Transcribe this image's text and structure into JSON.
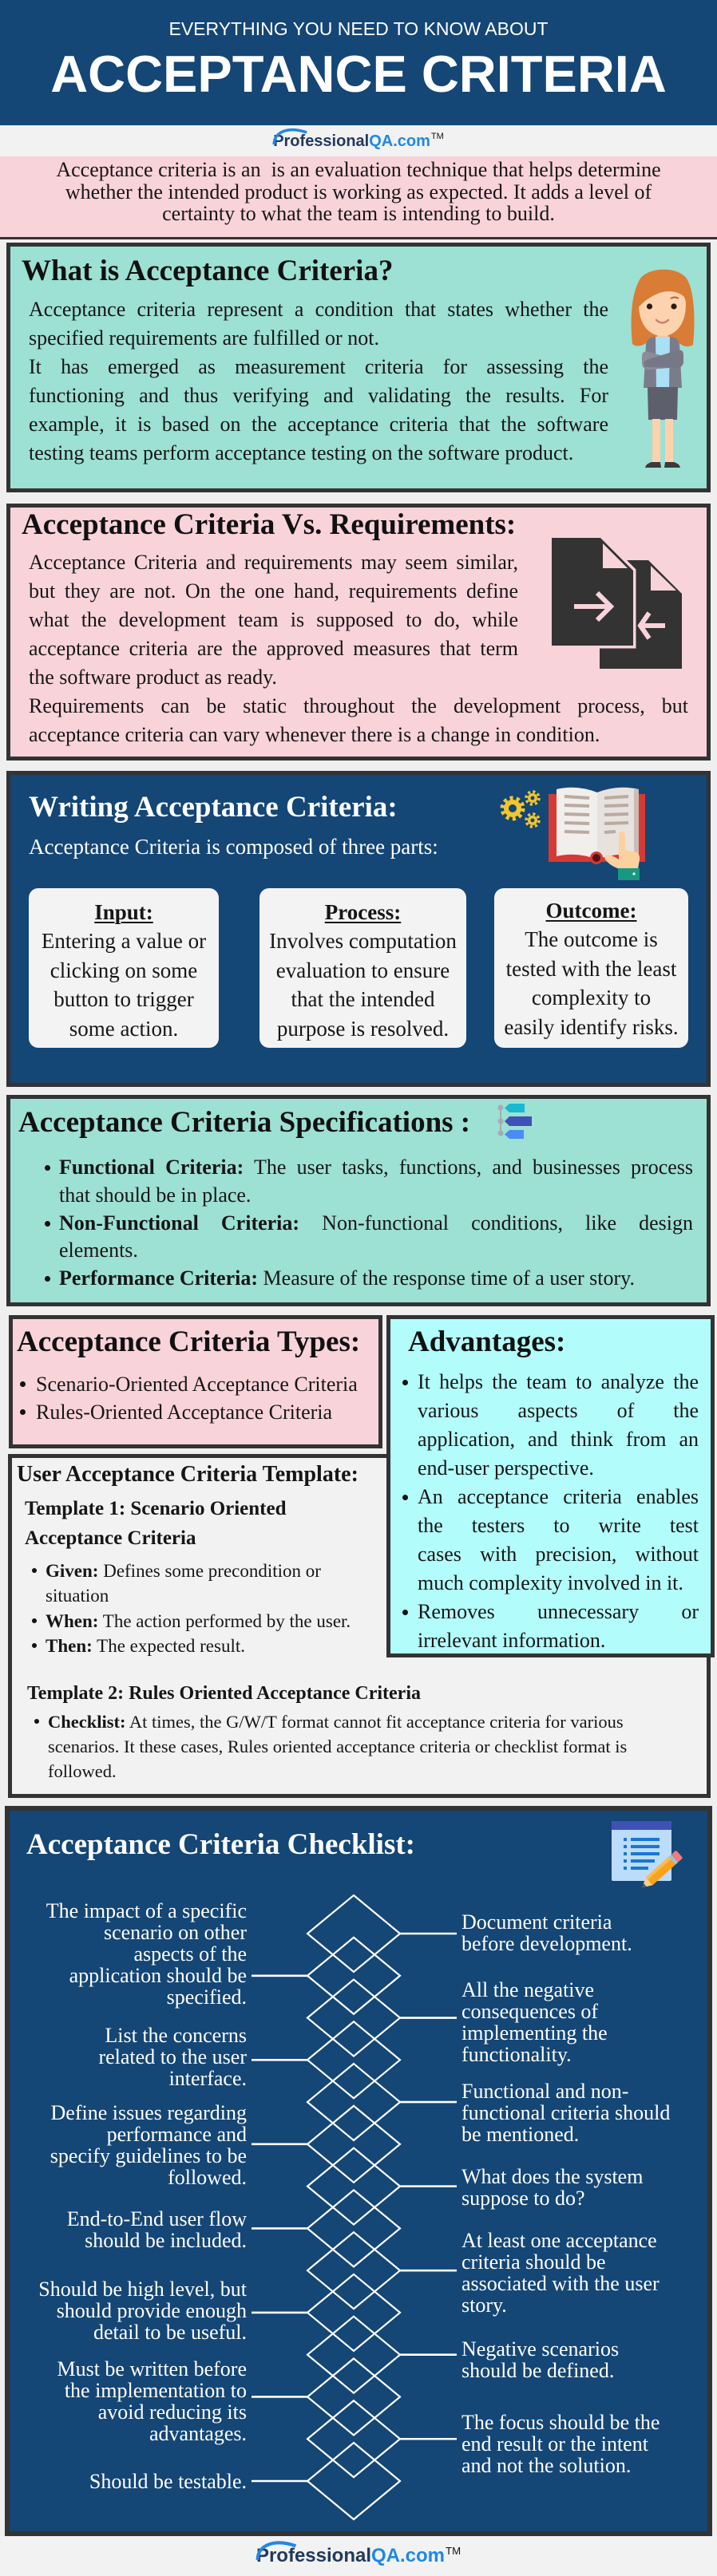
{
  "theme": {
    "header_bg": "#144676",
    "teal": "#9de0d4",
    "pink": "#f9d3da",
    "cyan": "#b3fcfc",
    "panel": "#f2f2f2",
    "border": "#333333",
    "logo_dark": "#213a5c",
    "logo_blue": "#1e88e5"
  },
  "header": {
    "eyebrow": "EVERYTHING YOU NEED TO KNOW ABOUT",
    "title": "ACCEPTANCE CRITERIA"
  },
  "logo": {
    "brand": "Professional",
    "brand_suffix": "QA.com",
    "trademark": "TM"
  },
  "intro": {
    "lines": [
      "Acceptance criteria is an  is an evaluation technique that helps determine",
      "whether the intended product is working as expected. It adds a level of",
      "certainty to what the team is intending to build."
    ]
  },
  "what_is": {
    "title": "What is Acceptance Criteria?",
    "illustration": "woman-illustration",
    "paragraphs": [
      [
        "Acceptance criteria represent a condition that states whether the",
        "specified requirements are fulfilled or not."
      ],
      [
        "It has emerged as measurement criteria for assessing the",
        "functioning and thus verifying and validating the results. For",
        "example, it is based on the acceptance criteria that the software",
        "testing teams perform acceptance testing on the software product."
      ]
    ]
  },
  "vs_requirements": {
    "title": "Acceptance Criteria Vs. Requirements:",
    "icon": "compare-documents-icon",
    "paragraphs": [
      [
        "Acceptance Criteria and requirements may seem similar,",
        "but they are not. On the one hand, requirements define",
        "what the development team is supposed to do, while",
        "acceptance criteria are the approved measures that term",
        "the software product as ready."
      ],
      [
        "Requirements can be static throughout the development process, but",
        "acceptance criteria can vary whenever there is a change in condition."
      ]
    ]
  },
  "writing": {
    "title": "Writing Acceptance Criteria:",
    "subtitle": "Acceptance Criteria is composed of three parts:",
    "icon": "book-gears-icon",
    "parts": [
      {
        "heading": "Input:",
        "lines": [
          "Entering a value or",
          "clicking on some",
          "button to trigger",
          "some action."
        ]
      },
      {
        "heading": "Process:",
        "lines": [
          "Involves computation",
          "evaluation to ensure",
          "that the intended",
          "purpose is resolved."
        ]
      },
      {
        "heading": "Outcome:",
        "lines": [
          "The outcome is",
          "tested with the least",
          "complexity to",
          "easily identify risks."
        ]
      }
    ]
  },
  "specifications": {
    "title": "Acceptance Criteria Specifications :",
    "icon": "hierarchy-tags-icon",
    "items": [
      {
        "label": "Functional Criteria:",
        "lines": [
          "The user tasks, functions, and businesses process",
          "that should be in place."
        ]
      },
      {
        "label": "Non-Functional Criteria:",
        "lines": [
          "Non-functional conditions, like design",
          "elements."
        ]
      },
      {
        "label": "Performance Criteria:",
        "lines": [
          "Measure of the response time of a user story."
        ]
      }
    ]
  },
  "types": {
    "title": "Acceptance Criteria Types:",
    "items": [
      "Scenario-Oriented Acceptance Criteria",
      "Rules-Oriented Acceptance Criteria"
    ]
  },
  "advantages": {
    "title": "Advantages:",
    "items": [
      {
        "lines": [
          "It helps the team to analyze the",
          "various aspects of the",
          "application, and think from an",
          "end-user perspective."
        ]
      },
      {
        "lines": [
          "An acceptance criteria enables",
          "the testers to write test",
          "cases with precision, without",
          "much complexity involved in it."
        ]
      },
      {
        "lines": [
          "Removes unnecessary or",
          "irrelevant information."
        ]
      }
    ]
  },
  "template": {
    "title": "User Acceptance Criteria Template:",
    "template1": {
      "heading_lines": [
        "Template 1: Scenario Oriented",
        "Acceptance Criteria"
      ],
      "items": [
        {
          "label": "Given:",
          "lines": [
            "Defines some precondition or",
            "situation"
          ]
        },
        {
          "label": "When:",
          "lines": [
            "The action performed by the user."
          ]
        },
        {
          "label": "Then:",
          "lines": [
            "The expected result."
          ]
        }
      ]
    },
    "template2": {
      "heading": "Template 2: Rules Oriented Acceptance Criteria",
      "items": [
        {
          "label": "Checklist:",
          "lines": [
            "At times, the G/W/T format cannot fit acceptance criteria for various",
            "scenarios. It these cases, Rules oriented acceptance criteria or checklist format is",
            "followed."
          ]
        }
      ]
    }
  },
  "checklist": {
    "title": "Acceptance Criteria Checklist:",
    "icon": "checklist-document-icon",
    "right": [
      {
        "lines": [
          "Document criteria",
          "before development."
        ]
      },
      {
        "lines": [
          "All the negative",
          "consequences of",
          "implementing the",
          "functionality."
        ]
      },
      {
        "lines": [
          "Functional and non-",
          "functional criteria should",
          "be mentioned."
        ]
      },
      {
        "lines": [
          "What does the system",
          "suppose to do?"
        ]
      },
      {
        "lines": [
          "At least one acceptance",
          "criteria should be",
          "associated with the user",
          "story."
        ]
      },
      {
        "lines": [
          "Negative scenarios",
          "should be defined."
        ]
      },
      {
        "lines": [
          "The focus should be the",
          "end result or the intent",
          "and not the solution."
        ]
      }
    ],
    "left": [
      {
        "lines": [
          "The impact of a specific",
          "scenario on other",
          "aspects of the",
          "application should be",
          "specified."
        ]
      },
      {
        "lines": [
          "List the concerns",
          "related to the user",
          "interface."
        ]
      },
      {
        "lines": [
          "Define issues regarding",
          "performance and",
          "specify guidelines to be",
          "followed."
        ]
      },
      {
        "lines": [
          "End-to-End user flow",
          "should be included."
        ]
      },
      {
        "lines": [
          "Should be high level, but",
          "should provide enough",
          "detail to be useful."
        ]
      },
      {
        "lines": [
          "Must be written before",
          "the implementation to",
          "avoid reducing its",
          "advantages."
        ]
      },
      {
        "lines": [
          "Should be testable."
        ]
      }
    ]
  }
}
